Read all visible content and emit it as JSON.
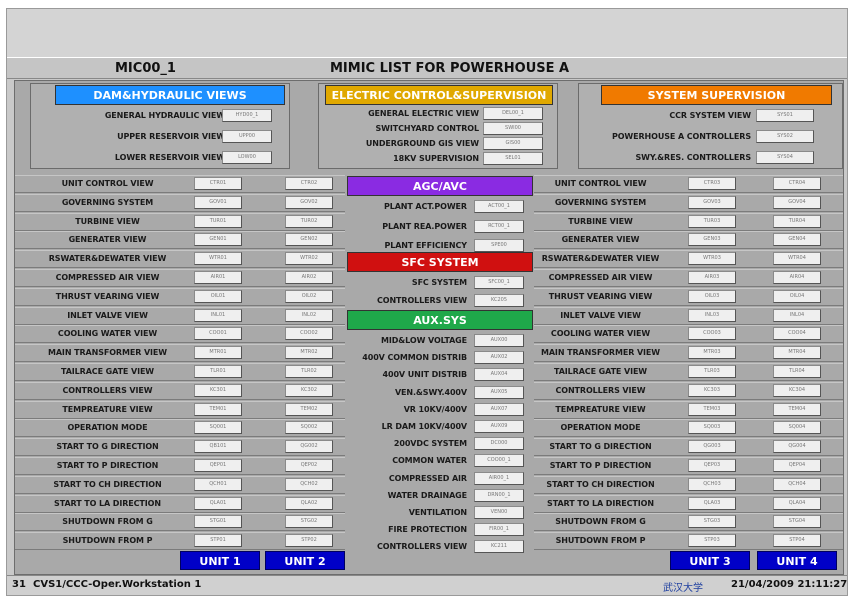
{
  "header": {
    "id": "MIC00_1",
    "title": "MIMIC LIST FOR POWERHOUSE A"
  },
  "top_sections": [
    {
      "title": "DAM&HYDRAULIC  VIEWS",
      "color": "#1e90ff",
      "items": [
        {
          "label": "GENERAL HYDRAULIC VIEW",
          "code": "HYD00_1"
        },
        {
          "label": "UPPER RESERVOIR VIEW",
          "code": "UPP00"
        },
        {
          "label": "LOWER RESERVOIR VIEW",
          "code": "LOW00"
        }
      ]
    },
    {
      "title": "ELECTRIC CONTROL&SUPERVISION",
      "color": "#e0a800",
      "items": [
        {
          "label": "GENERAL ELECTRIC VIEW",
          "code": "DEL00_1"
        },
        {
          "label": "SWITCHYARD CONTROL",
          "code": "SWI00"
        },
        {
          "label": "UNDERGROUND GIS VIEW",
          "code": "GIS00"
        },
        {
          "label": "18KV SUPERVISION",
          "code": "SEL01"
        }
      ]
    },
    {
      "title": "SYSTEM SUPERVISION",
      "color": "#f07a00",
      "items": [
        {
          "label": "CCR SYSTEM VIEW",
          "code": "SYS01"
        },
        {
          "label": "POWERHOUSE A CONTROLLERS",
          "code": "SYS02"
        },
        {
          "label": "SWY.&RES. CONTROLLERS",
          "code": "SYS04"
        }
      ]
    }
  ],
  "unit_views": [
    "UNIT CONTROL VIEW",
    "GOVERNING SYSTEM",
    "TURBINE VIEW",
    "GENERATER VIEW",
    "RSWATER&DEWATER VIEW",
    "COMPRESSED AIR VIEW",
    "THRUST VEARING VIEW",
    "INLET VALVE VIEW",
    "COOLING WATER VIEW",
    "MAIN TRANSFORMER VIEW",
    "TAILRACE GATE VIEW",
    "CONTROLLERS VIEW",
    "TEMPREATURE VIEW",
    "OPERATION MODE",
    "START TO G DIRECTION",
    "START TO P DIRECTION",
    "START TO CH DIRECTION",
    "START TO LA DIRECTION",
    "SHUTDOWN FROM G",
    "SHUTDOWN FROM P"
  ],
  "unit1_codes": [
    "CTR01",
    "GOV01",
    "TUR01",
    "GEN01",
    "WTR01",
    "AIR01",
    "OIL01",
    "INL01",
    "COO01",
    "MTR01",
    "TLR01",
    "KC301",
    "TEM01",
    "SQ001",
    "QB101",
    "QEP01",
    "QCH01",
    "QLA01",
    "STG01",
    "STP01"
  ],
  "unit2_codes": [
    "CTR02",
    "GOV02",
    "TUR02",
    "GEN02",
    "WTR02",
    "AIR02",
    "OIL02",
    "INL02",
    "COO02",
    "MTR02",
    "TLR02",
    "KC302",
    "TEM02",
    "SQ002",
    "QG002",
    "QEP02",
    "QCH02",
    "QLA02",
    "STG02",
    "STP02"
  ],
  "unit3_codes": [
    "CTR03",
    "GOV03",
    "TUR03",
    "GEN03",
    "WTR03",
    "AIR03",
    "OIL03",
    "INL03",
    "COO03",
    "MTR03",
    "TLR03",
    "KC303",
    "TEM03",
    "SQ003",
    "QG003",
    "QEP03",
    "QCH03",
    "QLA03",
    "STG03",
    "STP03"
  ],
  "unit4_codes": [
    "CTR04",
    "GOV04",
    "TUR04",
    "GEN04",
    "WTR04",
    "AIR04",
    "OIL04",
    "INL04",
    "COO04",
    "MTR04",
    "TLR04",
    "KC304",
    "TEM04",
    "SQ004",
    "QG004",
    "QEP04",
    "QCH04",
    "QLA04",
    "STG04",
    "STP04"
  ],
  "units": [
    "UNIT 1",
    "UNIT 2",
    "UNIT 3",
    "UNIT 4"
  ],
  "agc": {
    "title": "AGC/AVC",
    "color": "#8a2be2",
    "items": [
      {
        "label": "PLANT ACT.POWER",
        "code": "ACT00_1"
      },
      {
        "label": "PLANT REA.POWER",
        "code": "RCT00_1"
      },
      {
        "label": "PLANT EFFICIENCY",
        "code": "SPE00"
      }
    ]
  },
  "sfc": {
    "title": "SFC SYSTEM",
    "color": "#d01010",
    "items": [
      {
        "label": "SFC SYSTEM",
        "code": "SFC00_1"
      },
      {
        "label": "CONTROLLERS VIEW",
        "code": "KC205"
      }
    ]
  },
  "aux": {
    "title": "AUX.SYS",
    "color": "#1fa84a",
    "items": [
      {
        "label": "MID&LOW VOLTAGE",
        "code": "AUX00"
      },
      {
        "label": "400V COMMON DISTRIB",
        "code": "AUX02"
      },
      {
        "label": "400V UNIT DISTRIB",
        "code": "AUX04"
      },
      {
        "label": "VEN.&SWY.400V",
        "code": "AUX05"
      },
      {
        "label": "VR 10KV/400V",
        "code": "AUX07"
      },
      {
        "label": "LR DAM 10KV/400V",
        "code": "AUX09"
      },
      {
        "label": "200VDC SYSTEM",
        "code": "DC000"
      },
      {
        "label": "COMMON WATER",
        "code": "COO00_1"
      },
      {
        "label": "COMPRESSED AIR",
        "code": "AIR00_1"
      },
      {
        "label": "WATER DRAINAGE",
        "code": "DRN00_1"
      },
      {
        "label": "VENTILATION",
        "code": "VEN00"
      },
      {
        "label": "FIRE PROTECTION",
        "code": "FIR00_1"
      },
      {
        "label": "CONTROLLERS VIEW",
        "code": "KC211"
      }
    ]
  },
  "status": {
    "index": "31",
    "workstation": "CVS1/CCC-Oper.Workstation 1",
    "logo": "武汉大学",
    "datetime": "21/04/2009 21:11:27"
  }
}
